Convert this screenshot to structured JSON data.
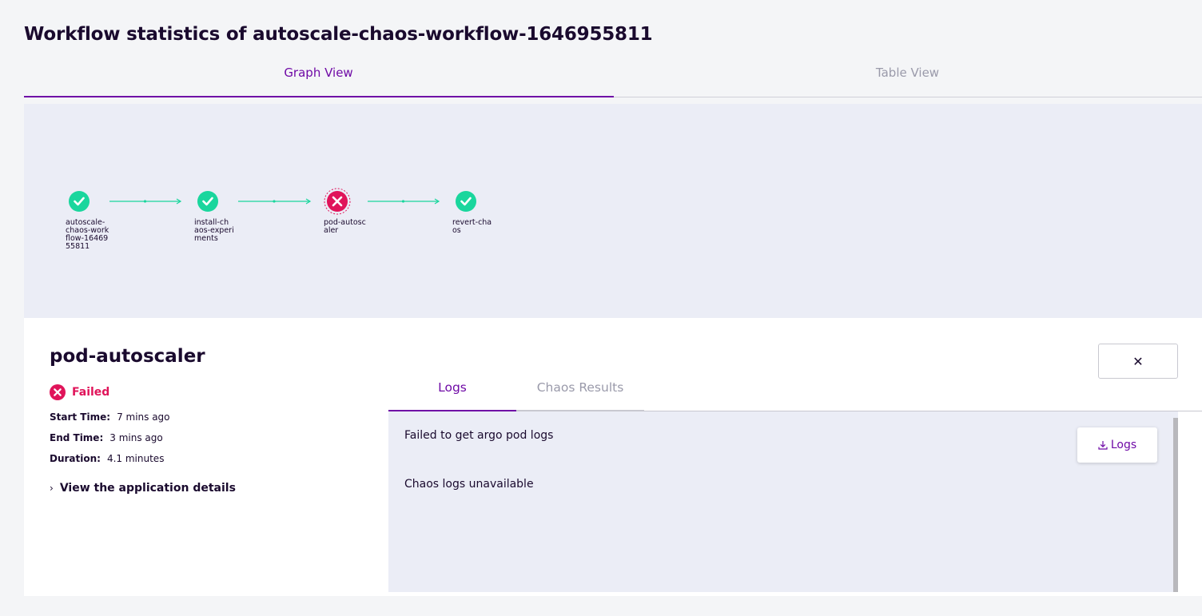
{
  "page": {
    "title": "Workflow statistics of autoscale-chaos-workflow-1646955811"
  },
  "view_tabs": {
    "graph": "Graph View",
    "table": "Table View"
  },
  "graph": {
    "nodes": [
      {
        "label": "autoscale-\nchaos-work\nflow-16469\n55811",
        "status": "succeeded"
      },
      {
        "label": "install-ch\naos-experi\nments",
        "status": "succeeded"
      },
      {
        "label": "pod-autosc\naler",
        "status": "failed"
      },
      {
        "label": "revert-cha\nos",
        "status": "succeeded"
      }
    ],
    "colors": {
      "success": "#1ad69d",
      "failed": "#e0145a",
      "edge": "#1ad69d"
    }
  },
  "node_details": {
    "title": "pod-autoscaler",
    "status": "Failed",
    "start_label": "Start Time:",
    "start_value": "7 mins ago",
    "end_label": "End Time:",
    "end_value": "3 mins ago",
    "duration_label": "Duration:",
    "duration_value": "4.1 minutes",
    "app_details": "View the application details",
    "close": "✕"
  },
  "log_tabs": {
    "logs": "Logs",
    "results": "Chaos Results"
  },
  "logs": {
    "line1": "Failed to get argo pod logs",
    "line2": "Chaos logs unavailable",
    "download_label": "Logs"
  },
  "theme": {
    "accent": "#6f0aa6",
    "danger": "#e0145a"
  }
}
